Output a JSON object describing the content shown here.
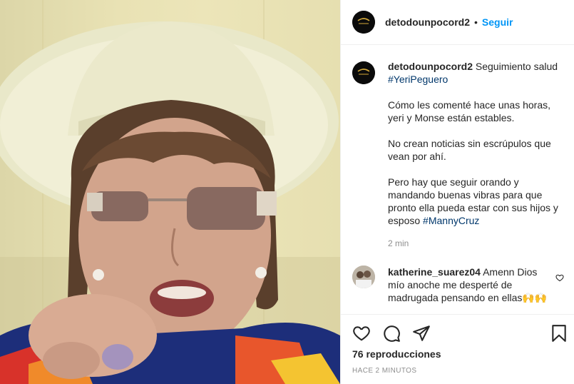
{
  "header": {
    "username": "detodounpocord2",
    "separator": "•",
    "follow_label": "Seguir",
    "avatar_icon": "brand-logo-icon"
  },
  "caption": {
    "username": "detodounpocord2",
    "line1": "Seguimiento salud",
    "hashtag1": "#YeriPeguero",
    "para1": "Cómo les comenté hace unas horas, yeri y Monse están estables.",
    "para2": "No crean noticias sin escrúpulos que vean por ahí.",
    "para3": "Pero hay que seguir orando y mandando buenas vibras para que pronto ella pueda estar con sus hijos y esposo",
    "hashtag2": "#MannyCruz",
    "time": "2 min"
  },
  "comment": {
    "username": "katherine_suarez04",
    "text": "Amenn Dios mío anoche me desperté de madrugada pensando en ellas",
    "emoji": "🙌🙌"
  },
  "actions": {
    "icons": [
      "heart-icon",
      "comment-icon",
      "share-icon",
      "bookmark-icon"
    ],
    "views": "76 reproducciones",
    "posted_ago": "HACE 2 MINUTOS"
  },
  "colors": {
    "accent": "#0095f6",
    "hashtag": "#00376b",
    "muted": "#8e8e8e",
    "text": "#262626"
  }
}
